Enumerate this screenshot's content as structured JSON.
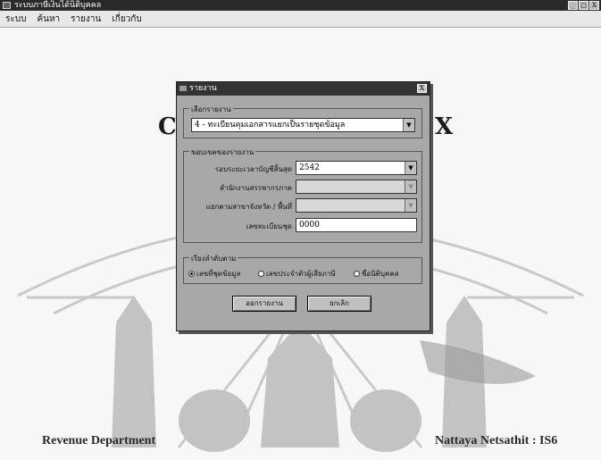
{
  "window": {
    "title": "ระบบภาษีเงินได้นิติบุคคล",
    "buttons": [
      "_",
      "□",
      "X"
    ]
  },
  "menu": [
    "ระบบ",
    "ค้นหา",
    "รายงาน",
    "เกี่ยวกับ"
  ],
  "background": {
    "left_letter": "C",
    "right_letter": "X",
    "footer_left": "Revenue Department",
    "footer_right": "Nattaya Netsathit : IS6"
  },
  "dialog": {
    "title": "รายงาน",
    "close_label": "X",
    "report_group_label": "เลือกรายงาน",
    "report_selected": "4 - ทะเบียนคุมเอกสารแยกเป็นรายชุดข้อมูล",
    "scope_group_label": "ขอบเขตของรายงาน",
    "fields": [
      {
        "label": "รอบระยะเวลาบัญชีสิ้นสุด",
        "value": "2542",
        "enabled": true
      },
      {
        "label": "สำนักงานสรรพากรภาค",
        "value": "",
        "enabled": false
      },
      {
        "label": "แยกตามสาขาจังหวัด / พื้นที่",
        "value": "",
        "enabled": false
      },
      {
        "label": "เลขทะเบียนชุด",
        "value": "0000",
        "enabled": true
      }
    ],
    "sort_group_label": "เรียงลำดับตาม",
    "sort_options": [
      {
        "label": "เลขที่ชุดข้อมูล",
        "selected": true
      },
      {
        "label": "เลขประจำตัวผู้เสียภาษี",
        "selected": false
      },
      {
        "label": "ชื่อนิติบุคคล",
        "selected": false
      }
    ],
    "buttons": {
      "ok": "ออกรายงาน",
      "cancel": "ยกเลิก"
    }
  }
}
